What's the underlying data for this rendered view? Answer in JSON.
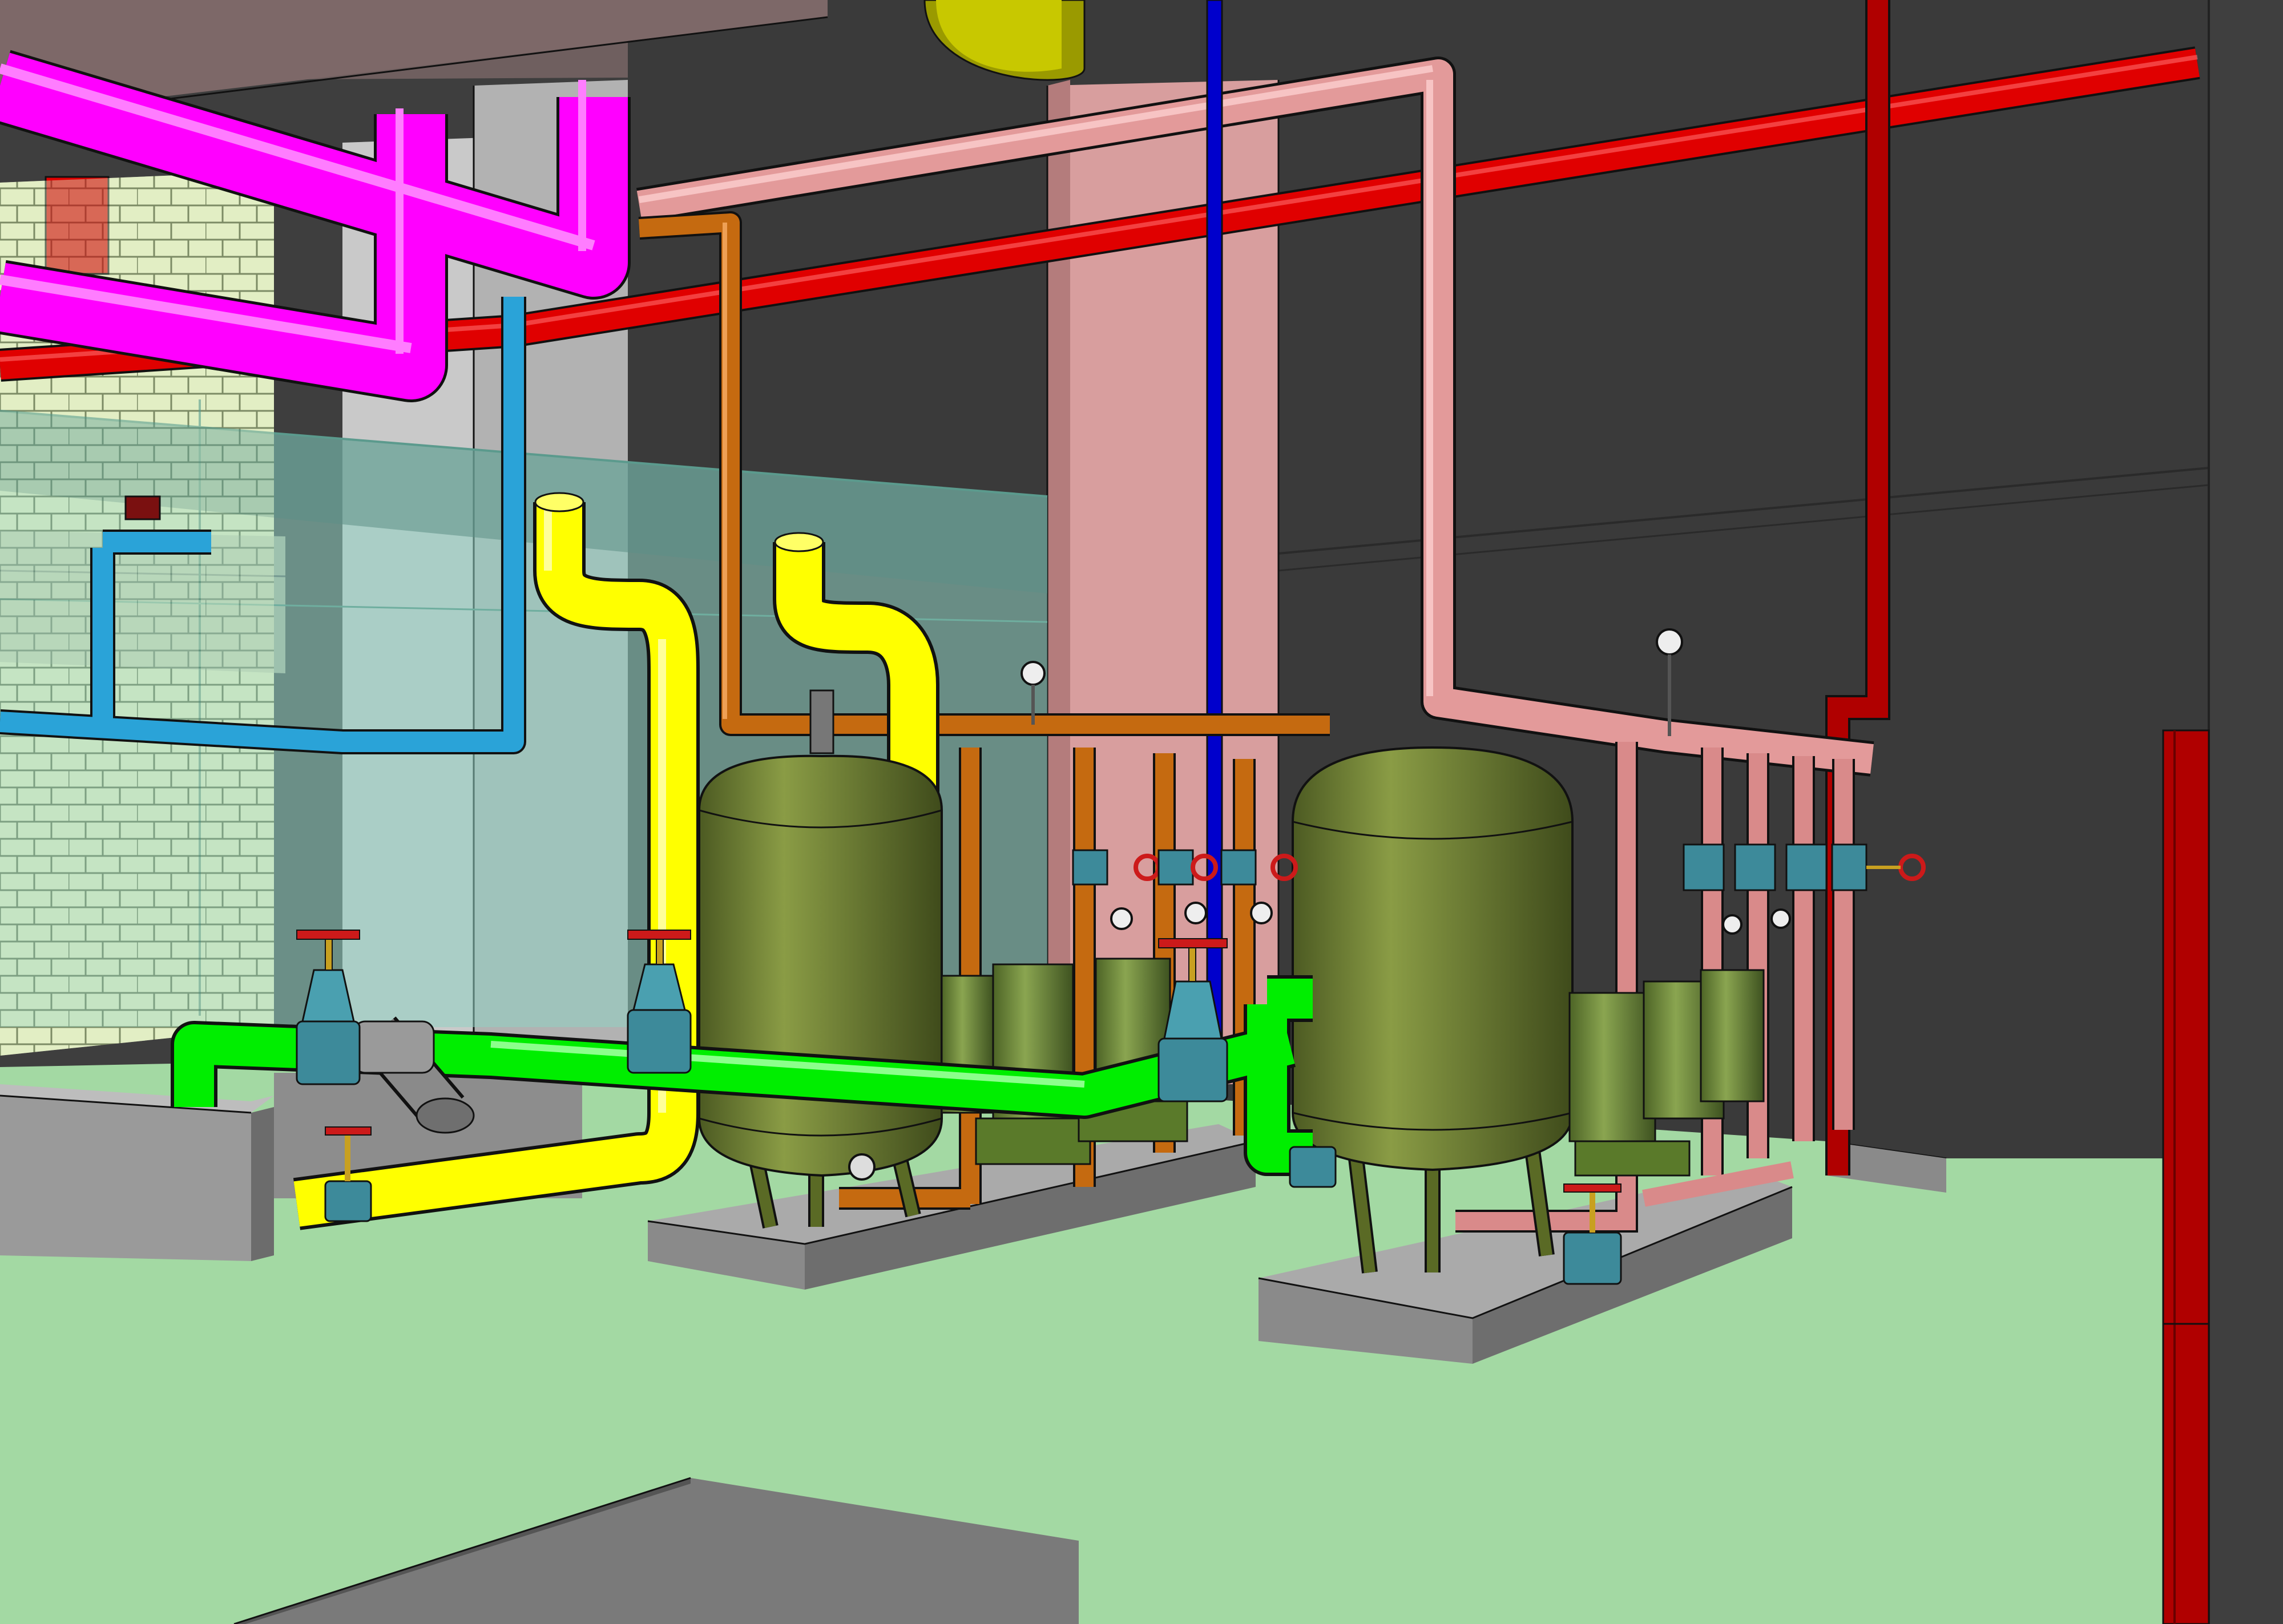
{
  "scene": {
    "type": "3d-bim-model-view",
    "subject": "mechanical-room",
    "colors": {
      "background": "#3c3c3c",
      "floor": "#a3d9a3",
      "concrete": "#8a8a8a",
      "wall_brick": "#f2f2c8",
      "wall_pink": "#d9a0a0",
      "glass": "#8fd1c2",
      "pipe_magenta": "#ff00ff",
      "pipe_red": "#e00000",
      "pipe_dark_red": "#b00000",
      "pipe_pink": "#e39a9a",
      "pipe_brown": "#c56a10",
      "pipe_yellow": "#ffff00",
      "pipe_green": "#00ee00",
      "pipe_blue": "#2aa3d8",
      "pipe_navy": "#0000cc",
      "tank": "#6b7d33",
      "valve_body": "#3d8a9a",
      "valve_wheel": "#cc1a1a",
      "pump": "#6f8a3a"
    },
    "equipment": {
      "tanks": [
        "expansion-tank-left",
        "expansion-tank-right"
      ],
      "pump_groups": [
        "pump-group-left",
        "pump-group-right"
      ],
      "gauges": 8
    }
  }
}
